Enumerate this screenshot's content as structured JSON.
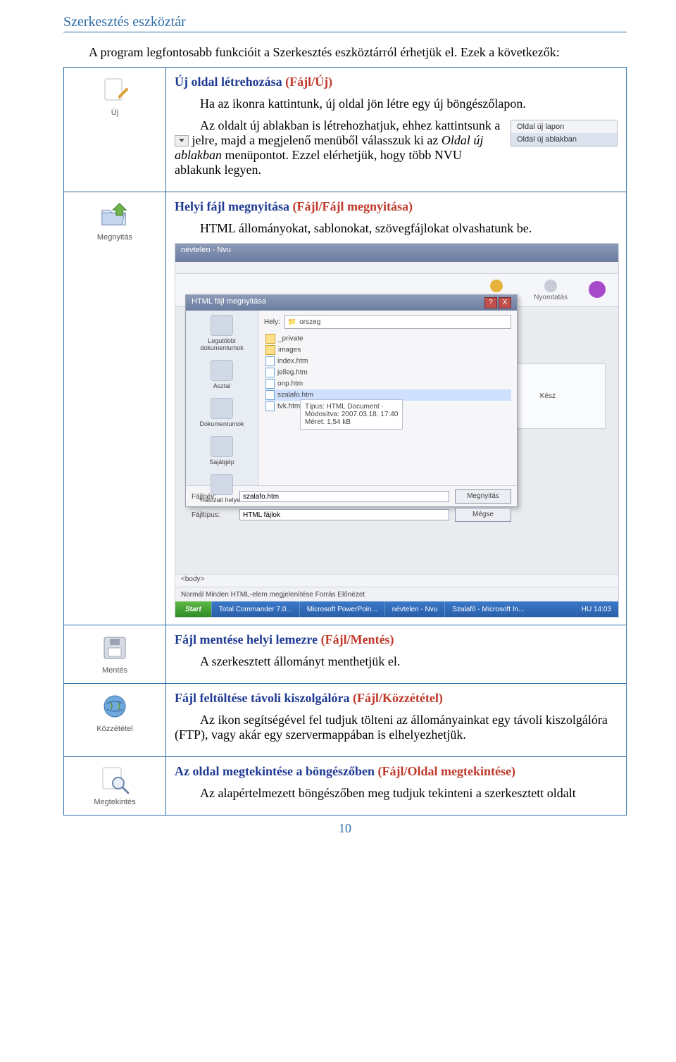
{
  "doc_title": "Szerkesztés eszköztár",
  "intro": {
    "l1": "A program legfontosabb funkcióit a Szerkesztés eszköztárról érhetjük el. Ezek a következők:"
  },
  "rows": {
    "uj": {
      "icon_label": "Új",
      "title_plain": "Új oldal létrehozása ",
      "title_red": "(Fájl/Új)",
      "p1": "Ha az ikonra kattintunk, új oldal jön létre egy új böngészőlapon.",
      "p2a": "Az oldalt új ablakban is létrehozhatjuk, ehhez kattintsunk a ",
      "p2b": " jelre, majd a megjelenő menüből válasszuk ki az ",
      "p2c_italic": "Oldal új ablakban",
      "p2d": " menüpontot. Ezzel elérhetjük, hogy több NVU ablakunk legyen.",
      "menu_items": [
        "Oldal új lapon",
        "Oldal új ablakban"
      ]
    },
    "megnyitas": {
      "icon_label": "Megnyitás",
      "title_plain": "Helyi fájl megnyitása ",
      "title_red": "(Fájl/Fájl megnyitása)",
      "p1": "HTML állományokat, sablonokat, szövegfájlokat olvashatunk be.",
      "shot": {
        "title": "névtelen - Nvu",
        "modal_title": "HTML fájl megnyitása",
        "loc_label": "Hely:",
        "loc_value": "orszeg",
        "side": [
          "Legutóbbi dokumentumok",
          "Asztal",
          "Dokumentumok",
          "Sajátgép",
          "Hálózati helyek"
        ],
        "files": [
          "_private",
          "images",
          "index.htm",
          "jelleg.htm",
          "onp.htm",
          "szalafo.htm",
          "tvk.htm"
        ],
        "tooltip_l1": "Típus: HTML Document ·",
        "tooltip_l2": "Módosítva: 2007.03.18. 17:40",
        "tooltip_l3": "Méret: 1,54 kB",
        "fn_label": "Fájlnév:",
        "fn_value": "szalafo.htm",
        "ft_label": "Fájltípus:",
        "ft_value": "HTML fájlok",
        "btn_open": "Megnyitás",
        "btn_cancel": "Mégse",
        "tabs": "Normál   Minden HTML-elem megjelenítése   Forrás   Előnézet",
        "bodytag": "<body>",
        "taskbar_start": "Start",
        "taskbar_items": [
          "Total Commander 7.0...",
          "Microsoft PowerPoin...",
          "névtelen - Nvu",
          "Szalafő - Microsoft In..."
        ],
        "clock": "HU   14:03",
        "toolbar": {
          "a": "Helyesírás",
          "b": "Nyomtatás",
          "c": ""
        },
        "side_right": "Kész"
      }
    },
    "mentes": {
      "icon_label": "Mentés",
      "title_plain": "Fájl mentése helyi lemezre ",
      "title_red": "(Fájl/Mentés)",
      "p1": "A szerkesztett állományt menthetjük el."
    },
    "kozzetetel": {
      "icon_label": "Közzététel",
      "title_plain": "Fájl feltöltése távoli kiszolgálóra ",
      "title_red": "(Fájl/Közzététel)",
      "p1": "Az ikon segítségével fel tudjuk tölteni az állományainkat egy távoli kiszolgálóra (FTP), vagy akár egy szervermappában is elhelyezhetjük."
    },
    "megtekintes": {
      "icon_label": "Megtekintés",
      "title_plain": "Az oldal megtekintése a böngészőben ",
      "title_red": "(Fájl/Oldal megtekintése)",
      "p1": "Az alapértelmezett böngészőben meg tudjuk tekinteni a szerkesztett oldalt"
    }
  },
  "page_num": "10"
}
